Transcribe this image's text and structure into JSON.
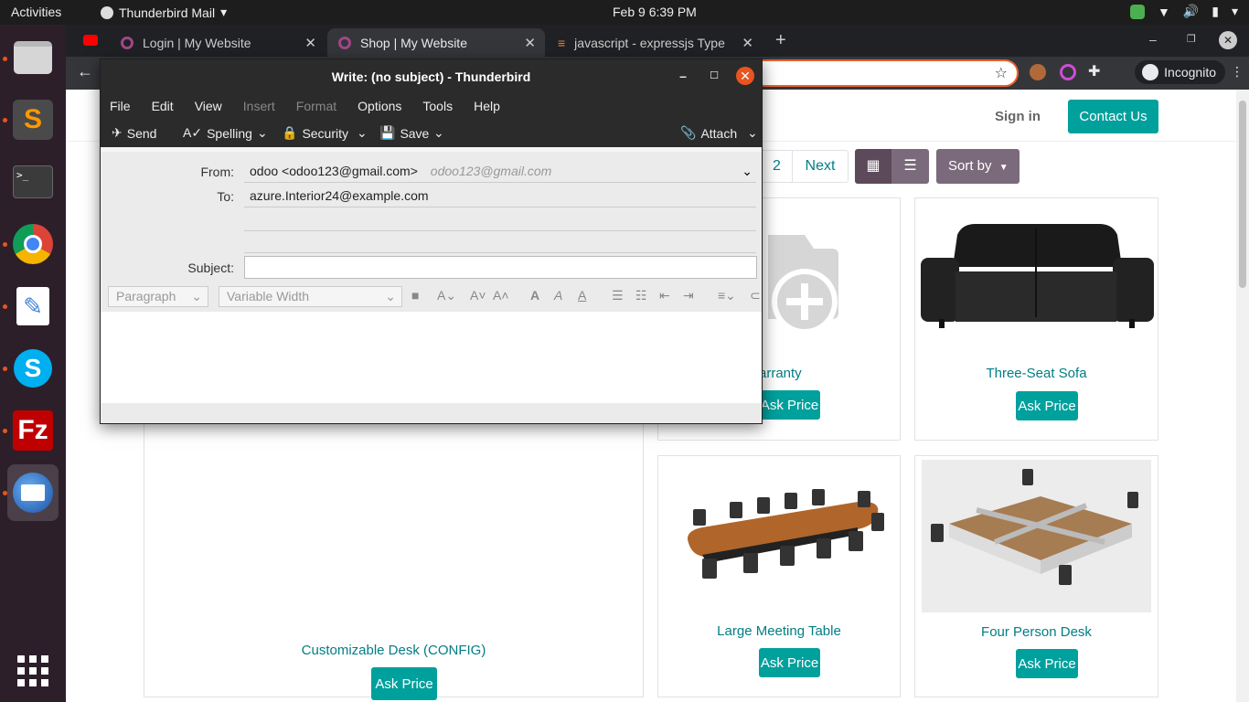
{
  "topbar": {
    "activities": "Activities",
    "app_name": "Thunderbird Mail",
    "clock": "Feb 9  6:39 PM"
  },
  "dock": {
    "items": [
      "files",
      "sublime-text",
      "terminal",
      "chrome",
      "text-editor",
      "skype",
      "filezilla",
      "thunderbird",
      "show-apps"
    ]
  },
  "browser": {
    "tabs": [
      {
        "label": "Login | My Website"
      },
      {
        "label": "Shop | My Website"
      },
      {
        "label": "javascript - expressjs Type"
      }
    ],
    "incognito_label": "Incognito"
  },
  "site": {
    "sign_in": "Sign in",
    "contact_us": "Contact Us",
    "pager_page": "2",
    "pager_next": "Next",
    "sort_by": "Sort by",
    "products": [
      {
        "title": "Customizable Desk (CONFIG)",
        "button": "Ask Price"
      },
      {
        "title": "Warranty",
        "visible_title": "arranty",
        "button": "Ask Price"
      },
      {
        "title": "Three-Seat Sofa",
        "button": "Ask Price"
      },
      {
        "title": "Large Meeting Table",
        "button": "Ask Price"
      },
      {
        "title": "Four Person Desk",
        "button": "Ask Price"
      }
    ]
  },
  "compose": {
    "window_title": "Write: (no subject) - Thunderbird",
    "menu": [
      "File",
      "Edit",
      "View",
      "Insert",
      "Format",
      "Options",
      "Tools",
      "Help"
    ],
    "commands": {
      "send": "Send",
      "spelling": "Spelling",
      "security": "Security",
      "save": "Save",
      "attach": "Attach"
    },
    "from_label": "From:",
    "from_value": "odoo <odoo123@gmail.com>",
    "from_hint": "odoo123@gmail.com",
    "to_label": "To:",
    "to_value": "azure.Interior24@example.com",
    "subject_label": "Subject:",
    "subject_value": "",
    "format": {
      "paragraph": "Paragraph",
      "font": "Variable Width"
    }
  }
}
